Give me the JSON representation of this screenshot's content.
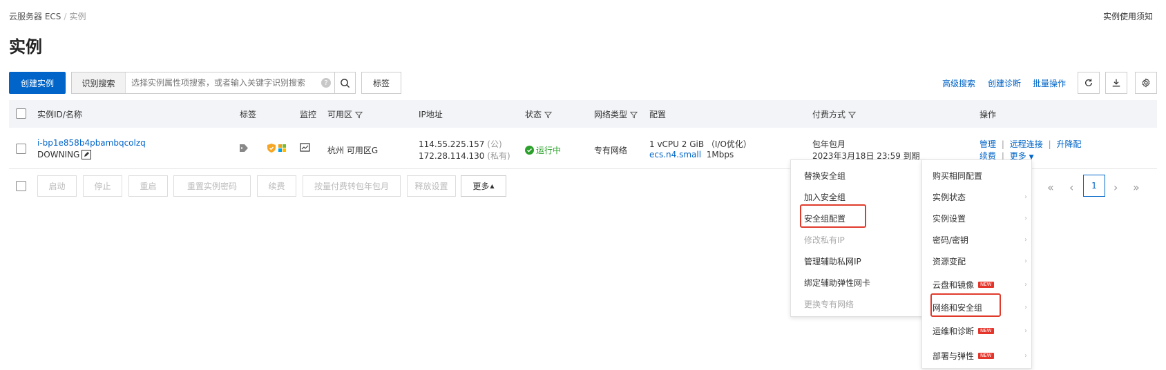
{
  "breadcrumb": {
    "root": "云服务器 ECS",
    "sep": "/",
    "current": "实例"
  },
  "header": {
    "notice_link": "实例使用须知",
    "title": "实例"
  },
  "toolbar": {
    "create_label": "创建实例",
    "search_tag": "识别搜索",
    "search_placeholder": "选择实例属性项搜索，或者输入关键字识别搜索",
    "help_glyph": "?",
    "tag_label": "标签",
    "advanced_search": "高级搜索",
    "create_diagnosis": "创建诊断",
    "batch_ops": "批量操作"
  },
  "table": {
    "headers": {
      "id_name": "实例ID/名称",
      "tag": "标签",
      "monitor": "监控",
      "zone": "可用区",
      "ip": "IP地址",
      "status": "状态",
      "network": "网络类型",
      "config": "配置",
      "billing": "付费方式",
      "actions": "操作"
    },
    "row": {
      "id": "i-bp1e858b4pbambqcolzq",
      "name": "DOWNING",
      "zone": "杭州 可用区G",
      "public_ip": "114.55.225.157",
      "public_tag": "(公)",
      "private_ip": "172.28.114.130",
      "private_tag": "(私有)",
      "status": "运行中",
      "network": "专有网络",
      "config_line1": "1 vCPU 2 GiB （I/O优化）",
      "config_type": "ecs.n4.small",
      "config_bw": "1Mbps",
      "billing_line1": "包年包月",
      "billing_line2": "2023年3月18日 23:59 到期",
      "action_manage": "管理",
      "action_remote": "远程连接",
      "action_upgrade": "升降配",
      "action_renew": "续费",
      "action_more": "更多",
      "divider": "|"
    }
  },
  "bulk": {
    "buttons": [
      "启动",
      "停止",
      "重启",
      "重置实例密码",
      "续费",
      "按量付费转包年包月",
      "释放设置"
    ],
    "more": "更多"
  },
  "pager": {
    "first": "«",
    "prev": "‹",
    "current": "1",
    "next": "›",
    "last": "»"
  },
  "submenu": {
    "items": [
      {
        "label": "替换安全组",
        "disabled": false
      },
      {
        "label": "加入安全组",
        "disabled": false
      },
      {
        "label": "安全组配置",
        "disabled": false
      },
      {
        "label": "修改私有IP",
        "disabled": true
      },
      {
        "label": "管理辅助私网IP",
        "disabled": false
      },
      {
        "label": "绑定辅助弹性网卡",
        "disabled": false
      },
      {
        "label": "更换专有网络",
        "disabled": true
      }
    ]
  },
  "moremenu": {
    "items": [
      {
        "label": "购买相同配置",
        "badge": "",
        "arrow": false
      },
      {
        "label": "实例状态",
        "badge": "",
        "arrow": true
      },
      {
        "label": "实例设置",
        "badge": "",
        "arrow": true
      },
      {
        "label": "密码/密钥",
        "badge": "",
        "arrow": true
      },
      {
        "label": "资源变配",
        "badge": "",
        "arrow": true
      },
      {
        "label": "云盘和镜像",
        "badge": "NEW",
        "arrow": true
      },
      {
        "label": "网络和安全组",
        "badge": "",
        "arrow": true
      },
      {
        "label": "运维和诊断",
        "badge": "NEW",
        "arrow": true
      },
      {
        "label": "部署与弹性",
        "badge": "NEW",
        "arrow": true
      }
    ]
  },
  "colors": {
    "primary": "#0064c8",
    "highlight": "#e03a2b",
    "running": "#2ba02b",
    "badge": "#e5352b"
  }
}
